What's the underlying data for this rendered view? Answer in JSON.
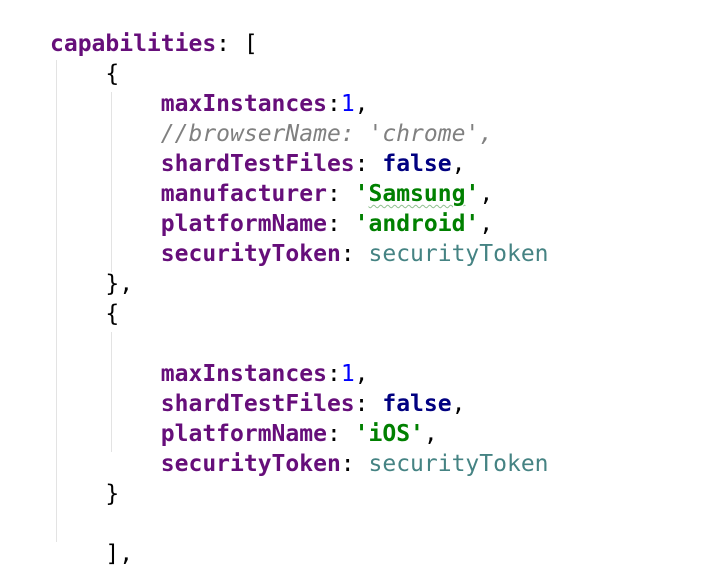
{
  "editor": {
    "lines": [
      [
        {
          "t": "capabilities",
          "s": "key"
        },
        {
          "t": ": [",
          "s": "punc"
        }
      ],
      [
        {
          "t": "    {",
          "s": "punc"
        }
      ],
      [
        {
          "t": "        ",
          "s": "punc"
        },
        {
          "t": "maxInstances",
          "s": "key"
        },
        {
          "t": ":",
          "s": "punc"
        },
        {
          "t": "1",
          "s": "num"
        },
        {
          "t": ",",
          "s": "punc"
        }
      ],
      [
        {
          "t": "        ",
          "s": "punc"
        },
        {
          "t": "//browserName: 'chrome',",
          "s": "comment"
        }
      ],
      [
        {
          "t": "        ",
          "s": "punc"
        },
        {
          "t": "shardTestFiles",
          "s": "key"
        },
        {
          "t": ": ",
          "s": "punc"
        },
        {
          "t": "false",
          "s": "kw"
        },
        {
          "t": ",",
          "s": "punc"
        }
      ],
      [
        {
          "t": "        ",
          "s": "punc"
        },
        {
          "t": "manufacturer",
          "s": "key"
        },
        {
          "t": ": ",
          "s": "punc"
        },
        {
          "t": "'",
          "s": "str"
        },
        {
          "t": "Samsung",
          "s": "str typo"
        },
        {
          "t": "'",
          "s": "str"
        },
        {
          "t": ",",
          "s": "punc"
        }
      ],
      [
        {
          "t": "        ",
          "s": "punc"
        },
        {
          "t": "platformName",
          "s": "key"
        },
        {
          "t": ": ",
          "s": "punc"
        },
        {
          "t": "'android'",
          "s": "str"
        },
        {
          "t": ",",
          "s": "punc"
        }
      ],
      [
        {
          "t": "        ",
          "s": "punc"
        },
        {
          "t": "securityToken",
          "s": "key"
        },
        {
          "t": ": ",
          "s": "punc"
        },
        {
          "t": "securityToken",
          "s": "ident"
        }
      ],
      [
        {
          "t": "    },",
          "s": "punc"
        }
      ],
      [
        {
          "t": "    {",
          "s": "punc"
        }
      ],
      [
        {
          "t": "",
          "s": "punc"
        }
      ],
      [
        {
          "t": "        ",
          "s": "punc"
        },
        {
          "t": "maxInstances",
          "s": "key"
        },
        {
          "t": ":",
          "s": "punc"
        },
        {
          "t": "1",
          "s": "num"
        },
        {
          "t": ",",
          "s": "punc"
        }
      ],
      [
        {
          "t": "        ",
          "s": "punc"
        },
        {
          "t": "shardTestFiles",
          "s": "key"
        },
        {
          "t": ": ",
          "s": "punc"
        },
        {
          "t": "false",
          "s": "kw"
        },
        {
          "t": ",",
          "s": "punc"
        }
      ],
      [
        {
          "t": "        ",
          "s": "punc"
        },
        {
          "t": "platformName",
          "s": "key"
        },
        {
          "t": ": ",
          "s": "punc"
        },
        {
          "t": "'iOS'",
          "s": "str"
        },
        {
          "t": ",",
          "s": "punc"
        }
      ],
      [
        {
          "t": "        ",
          "s": "punc"
        },
        {
          "t": "securityToken",
          "s": "key"
        },
        {
          "t": ": ",
          "s": "punc"
        },
        {
          "t": "securityToken",
          "s": "ident"
        }
      ],
      [
        {
          "t": "    }",
          "s": "punc"
        }
      ],
      [
        {
          "t": "",
          "s": "punc"
        }
      ],
      [
        {
          "t": "    ],",
          "s": "punc"
        }
      ]
    ]
  }
}
